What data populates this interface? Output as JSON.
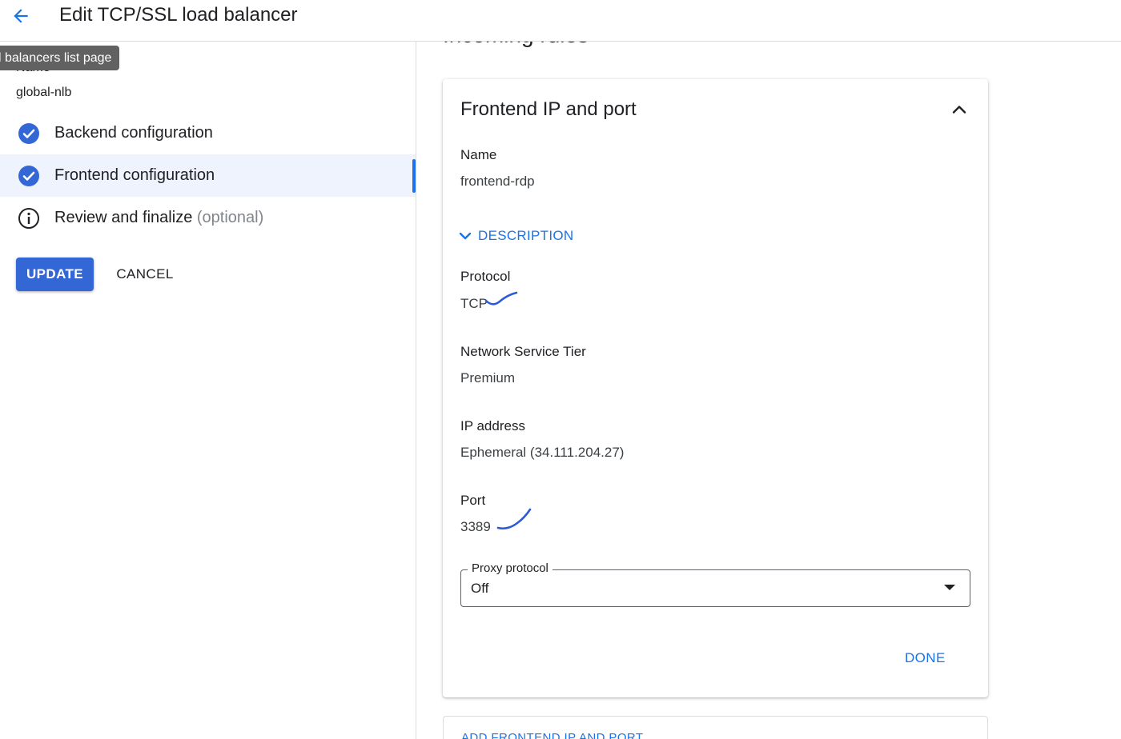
{
  "header": {
    "title": "Edit TCP/SSL load balancer",
    "back_icon": "arrow-back-icon"
  },
  "tooltip": {
    "text": "l balancers list page"
  },
  "left": {
    "name_label": "Name",
    "name_value": "global-nlb",
    "steps": [
      {
        "label": "Backend configuration",
        "suffix": "",
        "icon": "check-circle-icon",
        "status": "complete",
        "active": false
      },
      {
        "label": "Frontend configuration",
        "suffix": "",
        "icon": "check-circle-icon",
        "status": "complete",
        "active": true
      },
      {
        "label": "Review and finalize",
        "suffix": "(optional)",
        "icon": "info-icon",
        "status": "optional",
        "active": false
      }
    ],
    "update_label": "UPDATE",
    "cancel_label": "CANCEL"
  },
  "main": {
    "section_heading": "Incoming rules",
    "card": {
      "title": "Frontend IP and port",
      "collapse_icon": "chevron-up-icon",
      "name_label": "Name",
      "name_value": "frontend-rdp",
      "description_toggle": "DESCRIPTION",
      "protocol_label": "Protocol",
      "protocol_value": "TCP",
      "tier_label": "Network Service Tier",
      "tier_value": "Premium",
      "ip_label": "IP address",
      "ip_value": "Ephemeral (34.111.204.27)",
      "port_label": "Port",
      "port_value": "3389",
      "proxy_label": "Proxy protocol",
      "proxy_value": "Off",
      "done_label": "DONE"
    },
    "add_frontend_label": "ADD FRONTEND IP AND PORT"
  },
  "colors": {
    "accent": "#1a73e8",
    "primary_button": "#3367d6",
    "active_step_bg": "#eef3fd",
    "tooltip_bg": "#616161",
    "annotation_ink": "#2b5bd7"
  }
}
